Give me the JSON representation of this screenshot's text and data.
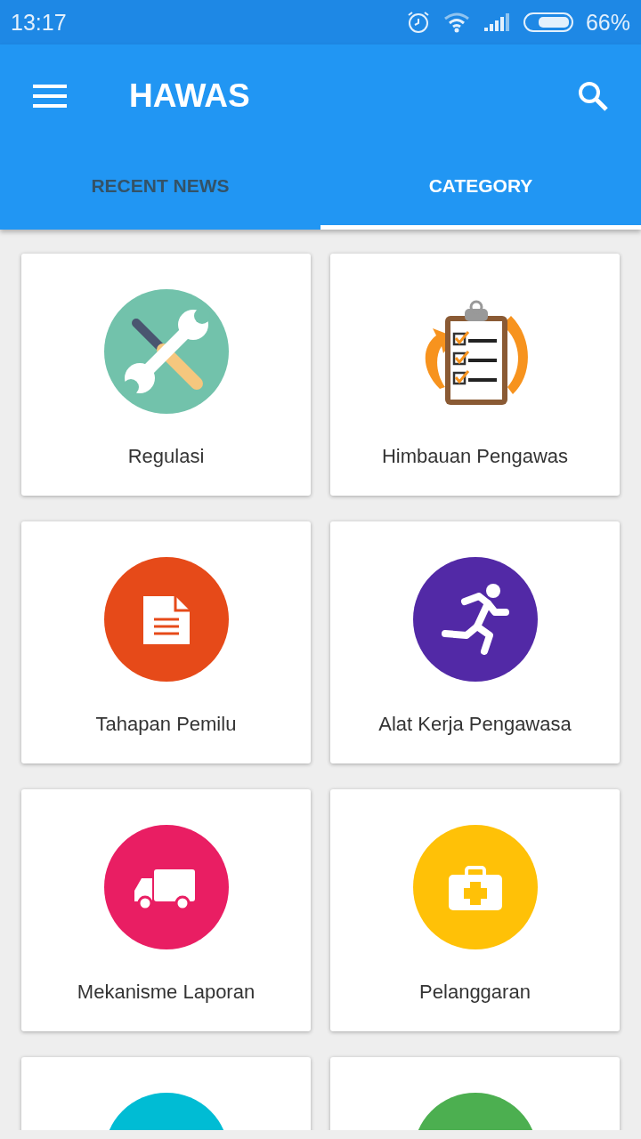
{
  "status_bar": {
    "time": "13:17",
    "battery": "66%"
  },
  "app_bar": {
    "title": "HAWAS"
  },
  "tabs": [
    {
      "label": "RECENT NEWS",
      "selected": false
    },
    {
      "label": "CATEGORY",
      "selected": true
    }
  ],
  "categories": [
    {
      "label": "Regulasi",
      "kind": "tools",
      "color": "#72c2ab"
    },
    {
      "label": "Himbauan Pengawas",
      "kind": "clipboard"
    },
    {
      "label": "Tahapan Pemilu",
      "kind": "document",
      "color": "#e64a19"
    },
    {
      "label": "Alat Kerja Pengawasa",
      "kind": "runner",
      "color": "#5229a6"
    },
    {
      "label": "Mekanisme Laporan",
      "kind": "truck",
      "color": "#e91e63"
    },
    {
      "label": "Pelanggaran",
      "kind": "firstaid",
      "color": "#ffc107"
    },
    {
      "kind": "blank",
      "color": "#00bcd4"
    },
    {
      "kind": "blank",
      "color": "#4caf50"
    }
  ]
}
